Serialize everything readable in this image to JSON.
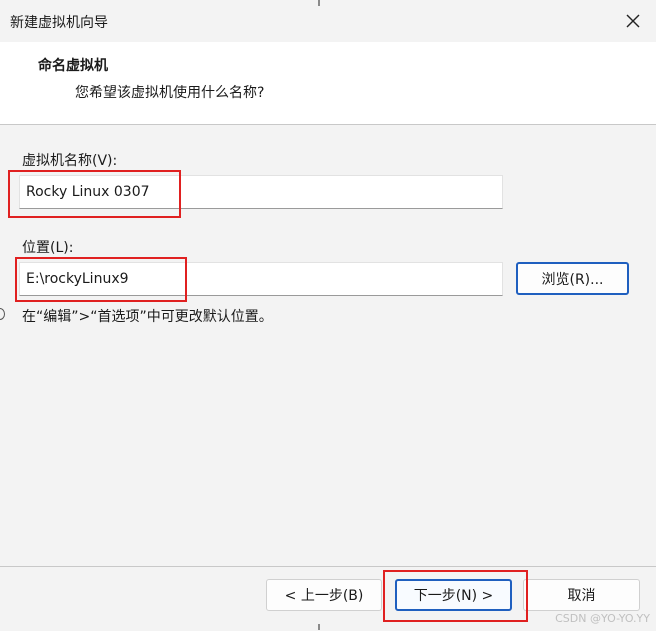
{
  "window": {
    "title": "新建虚拟机向导",
    "close_glyph": "✕"
  },
  "header": {
    "title": "命名虚拟机",
    "subtitle": "您希望该虚拟机使用什么名称?"
  },
  "vm_name": {
    "label": "虚拟机名称(V):",
    "value": "Rocky Linux 0307"
  },
  "location": {
    "label": "位置(L):",
    "value": "E:\\rockyLinux9",
    "browse_label": "浏览(R)..."
  },
  "hint": "在“编辑”>“首选项”中可更改默认位置。",
  "footer": {
    "back_label": "< 上一步(B)",
    "next_label": "下一步(N) >",
    "cancel_label": "取消"
  },
  "watermark": "CSDN @YO-YO.YY",
  "colors": {
    "highlight_box": "#e02020",
    "focus_border": "#1f5fbf"
  }
}
